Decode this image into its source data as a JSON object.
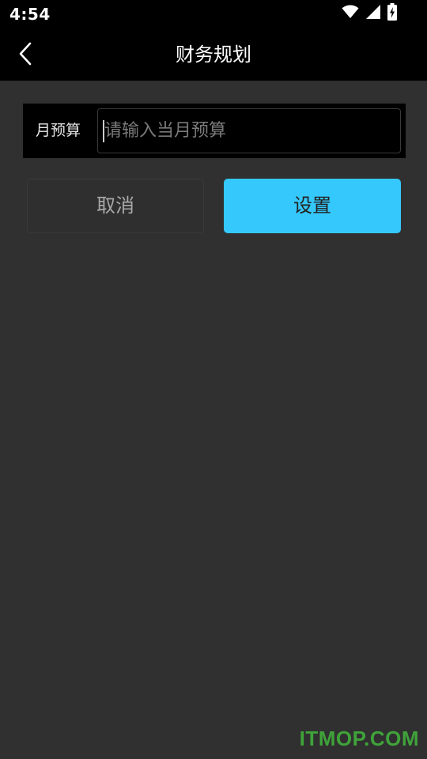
{
  "status_bar": {
    "time": "4:54",
    "icons": [
      "wifi-icon",
      "signal-icon",
      "battery-charging-icon"
    ]
  },
  "app_bar": {
    "title": "财务规划",
    "back_icon": "chevron-left-icon"
  },
  "budget": {
    "label": "月预算",
    "value": "",
    "placeholder": "请输入当月预算"
  },
  "actions": {
    "cancel_label": "取消",
    "set_label": "设置"
  },
  "watermark": {
    "text": "ITMOP.COM"
  },
  "colors": {
    "background": "#303030",
    "bar": "#000000",
    "accent": "#35c8fc",
    "watermark": "#3fa33a"
  }
}
